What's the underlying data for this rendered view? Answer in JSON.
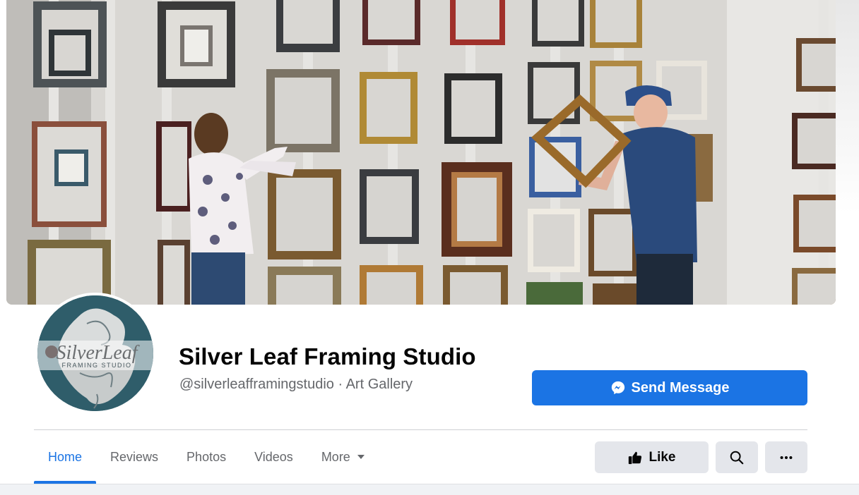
{
  "page": {
    "name": "Silver Leaf Framing Studio",
    "handle": "@silverleafframingstudio",
    "separator": " · ",
    "category": "Art Gallery"
  },
  "logo": {
    "title": "SilverLeaf",
    "subtitle": "FRAMING STUDIO"
  },
  "actions": {
    "send_message": "Send Message",
    "like": "Like"
  },
  "tabs": [
    {
      "label": "Home",
      "active": true
    },
    {
      "label": "Reviews"
    },
    {
      "label": "Photos"
    },
    {
      "label": "Videos"
    },
    {
      "label": "More"
    }
  ],
  "colors": {
    "accent": "#1b74e4",
    "secondary_text": "#65676b",
    "button_gray": "#e4e6eb",
    "avatar_bg": "#2f5d6a"
  },
  "icons": {
    "message": "messenger-icon",
    "like": "thumbs-up-icon",
    "search": "search-icon",
    "more": "ellipsis-icon",
    "dropdown": "caret-down-icon"
  }
}
